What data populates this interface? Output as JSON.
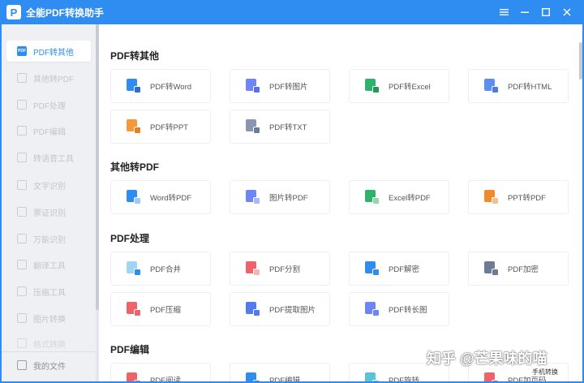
{
  "app": {
    "title": "全能PDF转换助手",
    "logo_letter": "P"
  },
  "window_controls": {
    "menu": "≡",
    "minimize": "–",
    "maximize": "□",
    "close": "✕"
  },
  "sidebar": {
    "items": [
      {
        "label": "PDF转其他",
        "icon": "pdf-convert-icon",
        "active": true
      },
      {
        "label": "其他转PDF",
        "icon": "to-pdf-icon"
      },
      {
        "label": "PDF处理",
        "icon": "pdf-process-icon"
      },
      {
        "label": "PDF编辑",
        "icon": "pdf-edit-icon"
      },
      {
        "label": "转语音工具",
        "icon": "voice-icon"
      },
      {
        "label": "文字识别",
        "icon": "ocr-icon"
      },
      {
        "label": "票证识别",
        "icon": "ticket-icon"
      },
      {
        "label": "万能识别",
        "icon": "universal-scan-icon"
      },
      {
        "label": "翻译工具",
        "icon": "translate-icon"
      },
      {
        "label": "压缩工具",
        "icon": "compress-icon"
      },
      {
        "label": "图片转换",
        "icon": "image-convert-icon"
      },
      {
        "label": "格式转换",
        "icon": "format-icon"
      }
    ],
    "bottom_item": {
      "label": "我的文件",
      "icon": "my-files-icon"
    }
  },
  "sections": [
    {
      "title": "PDF转其他",
      "cards": [
        {
          "label": "PDF转Word",
          "icon": "pdf-to-word-icon",
          "doc_color": "#2f8cf0",
          "badge_color": "#2b6fd6"
        },
        {
          "label": "PDF转图片",
          "icon": "pdf-to-image-icon",
          "doc_color": "#6e86f5",
          "badge_color": "#5a6fe8"
        },
        {
          "label": "PDF转Excel",
          "icon": "pdf-to-excel-icon",
          "doc_color": "#2fb36a",
          "badge_color": "#22985a"
        },
        {
          "label": "PDF转HTML",
          "icon": "pdf-to-html-icon",
          "doc_color": "#5d8ff0",
          "badge_color": "#4a7de0"
        },
        {
          "label": "PDF转PPT",
          "icon": "pdf-to-ppt-icon",
          "doc_color": "#f59a3a",
          "badge_color": "#ec7e1c"
        },
        {
          "label": "PDF转TXT",
          "icon": "pdf-to-txt-icon",
          "doc_color": "#8a96b0",
          "badge_color": "#6e7b96"
        }
      ]
    },
    {
      "title": "其他转PDF",
      "cards": [
        {
          "label": "Word转PDF",
          "icon": "word-to-pdf-icon",
          "doc_color": "#2f8cf0",
          "badge_color": "#9ec8f7"
        },
        {
          "label": "图片转PDF",
          "icon": "image-to-pdf-icon",
          "doc_color": "#6e86f5",
          "badge_color": "#aab8f7"
        },
        {
          "label": "Excel转PDF",
          "icon": "excel-to-pdf-icon",
          "doc_color": "#2fb36a",
          "badge_color": "#92d6ae"
        },
        {
          "label": "PPT转PDF",
          "icon": "ppt-to-pdf-icon",
          "doc_color": "#f08a2c",
          "badge_color": "#f6c08c"
        }
      ]
    },
    {
      "title": "PDF处理",
      "cards": [
        {
          "label": "PDF合并",
          "icon": "pdf-merge-icon",
          "doc_color": "#9fd6f5",
          "badge_color": "#2f8cf0"
        },
        {
          "label": "PDF分割",
          "icon": "pdf-split-icon",
          "doc_color": "#f0626a",
          "badge_color": "#f5b4b8"
        },
        {
          "label": "PDF解密",
          "icon": "pdf-decrypt-icon",
          "doc_color": "#2f8cf0",
          "badge_color": "#2f8cf0"
        },
        {
          "label": "PDF加密",
          "icon": "pdf-encrypt-icon",
          "doc_color": "#6e7b96",
          "badge_color": "#6e7b96"
        },
        {
          "label": "PDF压缩",
          "icon": "pdf-compress-icon",
          "doc_color": "#f0626a",
          "badge_color": "#f0626a"
        },
        {
          "label": "PDF提取图片",
          "icon": "pdf-extract-image-icon",
          "doc_color": "#4f7df0",
          "badge_color": "#4f7df0"
        },
        {
          "label": "PDF转长图",
          "icon": "pdf-long-image-icon",
          "doc_color": "#6e86f5",
          "badge_color": "#6e86f5"
        }
      ]
    },
    {
      "title": "PDF编辑",
      "cards": [
        {
          "label": "PDF阅读",
          "icon": "pdf-read-icon",
          "doc_color": "#f0626a",
          "badge_color": "#f0626a"
        },
        {
          "label": "PDF编辑",
          "icon": "pdf-edit-card-icon",
          "doc_color": "#2f8cf0",
          "badge_color": "#2f8cf0"
        },
        {
          "label": "PDF旋转",
          "icon": "pdf-rotate-icon",
          "doc_color": "#5bc3d6",
          "badge_color": "#5bc3d6"
        },
        {
          "label": "PDF加页码",
          "icon": "pdf-page-number-icon",
          "doc_color": "#f0626a",
          "badge_color": "#f0626a"
        }
      ]
    }
  ],
  "watermark": "知乎 @芒果味的喵",
  "mobile_sync": "手机转换"
}
